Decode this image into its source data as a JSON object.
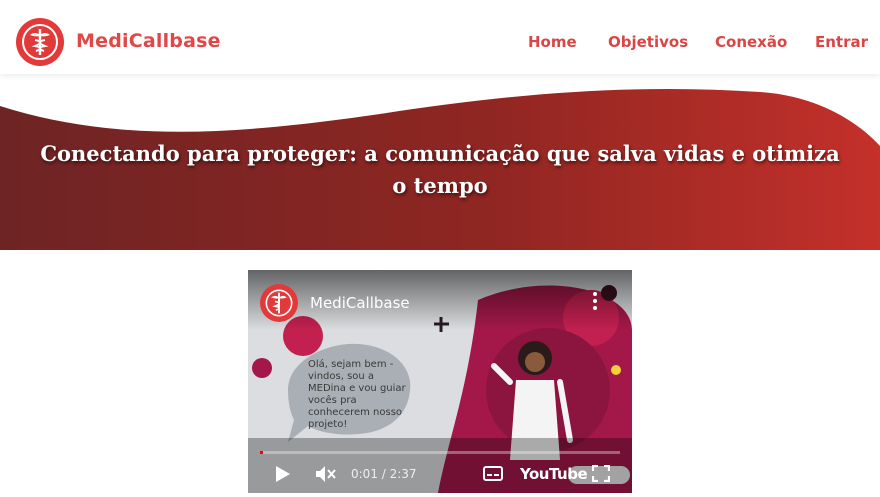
{
  "header": {
    "brand": "MediCallbase",
    "nav": [
      {
        "label": "Home"
      },
      {
        "label": "Objetivos"
      },
      {
        "label": "Conexão"
      },
      {
        "label": "Entrar"
      }
    ]
  },
  "hero": {
    "title": "Conectando para proteger: a comunicação que salva vidas e otimiza o tempo"
  },
  "video": {
    "channel_name": "MediCallbase",
    "speech": "Olá, sejam bem - vindos, sou a MEDina e vou guiar vocês pra conhecerem nosso projeto!",
    "time": "0:01 / 2:37",
    "platform": "YouTube",
    "progress_fraction": 0.004
  },
  "colors": {
    "brand_red": "#e04848",
    "hero_dark": "#6e2424",
    "hero_light": "#c4302a"
  }
}
